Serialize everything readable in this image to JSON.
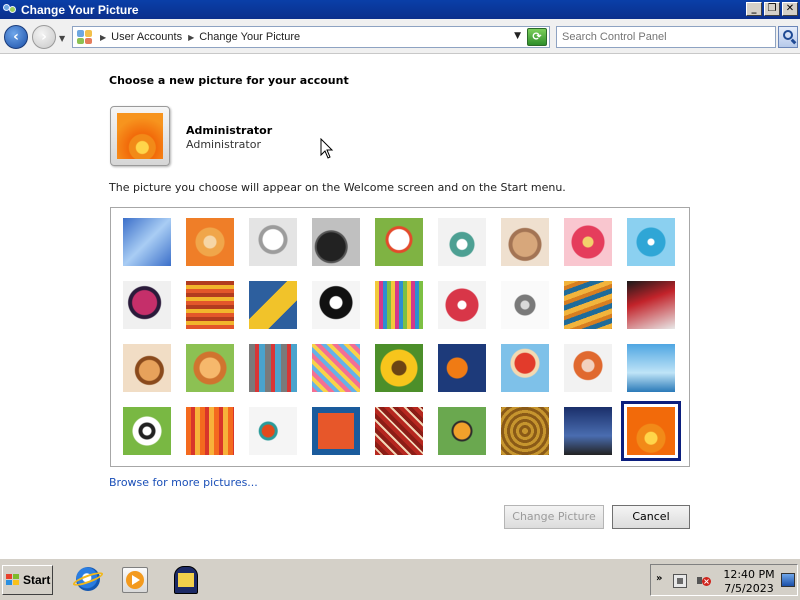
{
  "window": {
    "title": "Change Your Picture",
    "buttons": {
      "minimize": "_",
      "restore": "❐",
      "close": "✕"
    }
  },
  "address_bar": {
    "back_icon": "arrow-left-icon",
    "forward_icon": "arrow-right-icon",
    "breadcrumbs": [
      "User Accounts",
      "Change Your Picture"
    ],
    "search_placeholder": "Search Control Panel"
  },
  "main": {
    "heading": "Choose a new picture for your account",
    "user": {
      "name": "Administrator",
      "account_type": "Administrator"
    },
    "description": "The picture you choose will appear on the Welcome screen and on the Start menu.",
    "pictures": [
      {
        "name": "roller-coaster"
      },
      {
        "name": "starfish"
      },
      {
        "name": "robot-dog"
      },
      {
        "name": "record-player"
      },
      {
        "name": "lucky-cat"
      },
      {
        "name": "gyroscope"
      },
      {
        "name": "kitten"
      },
      {
        "name": "gerbera-pink"
      },
      {
        "name": "pinwheel"
      },
      {
        "name": "ball-spiral"
      },
      {
        "name": "fabric"
      },
      {
        "name": "yellow-leaf"
      },
      {
        "name": "dog-border-collie"
      },
      {
        "name": "crayons"
      },
      {
        "name": "red-star"
      },
      {
        "name": "jacks"
      },
      {
        "name": "stairs"
      },
      {
        "name": "origami-crane"
      },
      {
        "name": "guitar"
      },
      {
        "name": "pomeranian"
      },
      {
        "name": "toy-robot"
      },
      {
        "name": "hammock"
      },
      {
        "name": "sunflower"
      },
      {
        "name": "fish"
      },
      {
        "name": "hot-air-balloon"
      },
      {
        "name": "daruma"
      },
      {
        "name": "sailboat"
      },
      {
        "name": "soccer-ball"
      },
      {
        "name": "orange-fabric"
      },
      {
        "name": "marbles"
      },
      {
        "name": "window-tile"
      },
      {
        "name": "woven-textile"
      },
      {
        "name": "butterfly"
      },
      {
        "name": "basket"
      },
      {
        "name": "lighthouse"
      },
      {
        "name": "orange-flower"
      }
    ],
    "selected_index": 35,
    "browse_link": "Browse for more pictures...",
    "change_button": "Change Picture",
    "cancel_button": "Cancel"
  },
  "taskbar": {
    "start_label": "Start",
    "clock_time": "12:40 PM",
    "clock_date": "7/5/2023",
    "tray_chevron": "»"
  }
}
